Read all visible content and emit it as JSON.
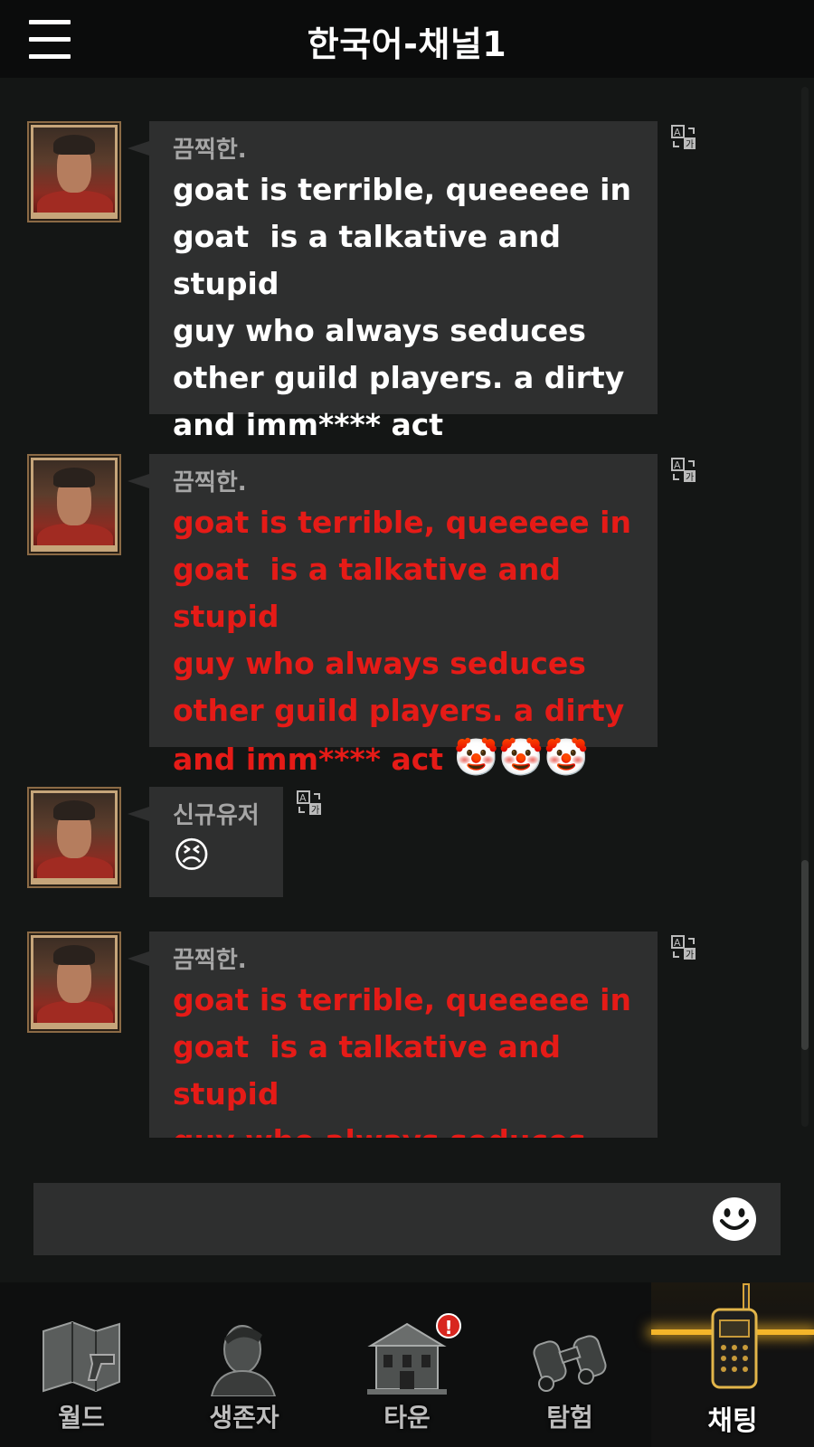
{
  "header": {
    "title": "한국어-채널1",
    "menu_icon": "hamburger-menu-icon"
  },
  "messages": [
    {
      "sender": "끔찍한.",
      "text": "goat is terrible, queeeee in\ngoat  is a talkative and stupid\nguy who always seduces\nother guild players. a dirty\nand imm**** act",
      "color": "#ffffff",
      "emoji": ""
    },
    {
      "sender": "끔찍한.",
      "text": "goat is terrible, queeeee in\ngoat  is a talkative and stupid\nguy who always seduces\nother guild players. a dirty\nand imm**** act ",
      "color": "#e51b17",
      "emoji": "🤡🤡🤡"
    },
    {
      "sender": "신규유저",
      "text": "",
      "color": "#ffffff",
      "emoji": "😣"
    },
    {
      "sender": "끔찍한.",
      "text": "goat is terrible, queeeee in\ngoat  is a talkative and stupid\nguy who always seduces\nother guild players. a dirty",
      "color": "#e51b17",
      "emoji": ""
    }
  ],
  "input": {
    "placeholder": "",
    "value": ""
  },
  "nav": {
    "items": [
      {
        "label": "월드",
        "icon": "world-map-icon"
      },
      {
        "label": "생존자",
        "icon": "survivor-icon"
      },
      {
        "label": "타운",
        "icon": "town-building-icon",
        "badge": "!"
      },
      {
        "label": "탐험",
        "icon": "binoculars-icon"
      },
      {
        "label": "채팅",
        "icon": "walkie-talkie-icon",
        "active": true
      }
    ]
  },
  "colors": {
    "accent": "#f4b52a",
    "alert_red": "#e51b17",
    "bubble": "#2e2f2f",
    "background": "#141615"
  }
}
